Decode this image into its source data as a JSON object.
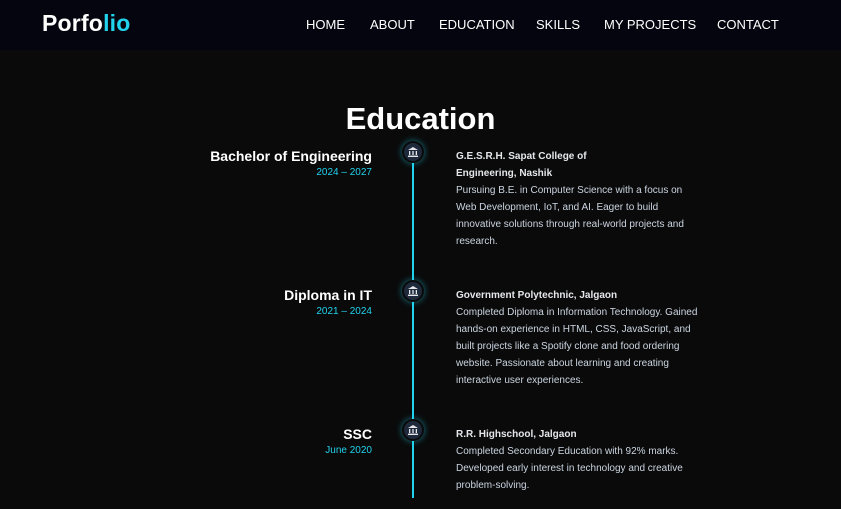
{
  "nav": {
    "logo_main": "Porfo",
    "logo_accent": "lio",
    "links": [
      "HOME",
      "ABOUT",
      "EDUCATION",
      "SKILLS",
      "MY PROJECTS",
      "CONTACT"
    ]
  },
  "section_title": "Education",
  "timeline": [
    {
      "degree": "Bachelor of Engineering",
      "years": "2024 – 2027",
      "institution": "G.E.S.R.H. Sapat College of Engineering, Nashik",
      "description": "Pursuing B.E. in Computer Science with a focus on Web Development, IoT, and AI. Eager to build innovative solutions through real-world projects and research."
    },
    {
      "degree": "Diploma in IT",
      "years": "2021 – 2024",
      "institution": "Government Polytechnic, Jalgaon",
      "description": "Completed Diploma in Information Technology. Gained hands-on experience in HTML, CSS, JavaScript, and built projects like a Spotify clone and food ordering website. Passionate about learning and creating interactive user experiences."
    },
    {
      "degree": "SSC",
      "years": "June 2020",
      "institution": "R.R. Highschool, Jalgaon",
      "description": "Completed Secondary Education with 92% marks. Developed early interest in technology and creative problem-solving."
    }
  ],
  "colors": {
    "accent": "#22d3ee",
    "background": "#0a0a0a",
    "navbar": "#05050f"
  },
  "icons": {
    "timeline_marker": "university-icon"
  }
}
